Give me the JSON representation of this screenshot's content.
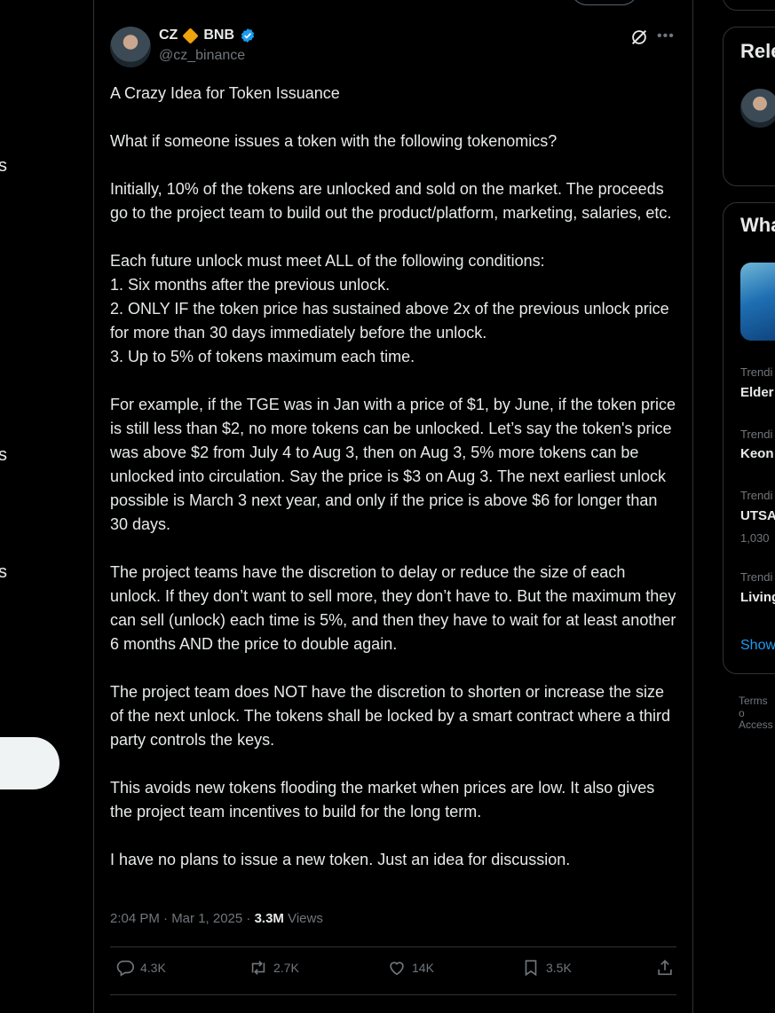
{
  "left_nav": {
    "frag_1": "s",
    "frag_2": "s",
    "frag_3": "s"
  },
  "tweet": {
    "author_name": "CZ",
    "author_brand": "BNB",
    "author_handle": "@cz_binance",
    "body": "A Crazy Idea for Token Issuance\n\nWhat if someone issues a token with the following tokenomics?\n\nInitially, 10% of the tokens are unlocked and sold on the market. The proceeds go to the project team to build out the product/platform, marketing, salaries, etc.\n\nEach future unlock must meet ALL of the following conditions:\n1. Six months after the previous unlock.\n2. ONLY IF the token price has sustained above 2x of the previous unlock price for more than 30 days immediately before the unlock.\n3. Up to 5% of tokens maximum each time.\n\nFor example, if the TGE was in Jan with a price of $1, by June, if the token price is still less than $2, no more tokens can be unlocked. Let’s say the token's price was above $2 from July 4 to Aug 3, then on Aug 3, 5% more tokens can be unlocked into circulation. Say the price is $3 on Aug 3. The next earliest unlock possible is March 3 next year, and only if the price is above $6 for longer than 30 days.\n\nThe project teams have the discretion to delay or reduce the size of each unlock. If they don’t want to sell more, they don’t have to. But the maximum they can sell (unlock) each time is 5%, and then they have to wait for at least another 6 months AND the price to double again.\n\nThe project team does NOT have the discretion to shorten or increase the size of the next unlock. The tokens shall be locked by a smart contract where a third party controls the keys.\n\nThis avoids new tokens flooding the market when prices are low. It also gives the project team incentives to build for the long term.\n\nI have no plans to issue a new token. Just an idea for discussion.",
    "timestamp": "2:04 PM · Mar 1, 2025 · ",
    "views_count": "3.3M",
    "views_label": " Views",
    "replies": "4.3K",
    "reposts": "2.7K",
    "likes": "14K",
    "bookmarks": "3.5K"
  },
  "right_sidebar": {
    "relevant_title": "Rele",
    "whats_title": "Wha",
    "trends": [
      {
        "label": "Trendi",
        "name": "Elder",
        "count": ""
      },
      {
        "label": "Trendi",
        "name": "Keon",
        "count": ""
      },
      {
        "label": "Trendi",
        "name": "UTSA",
        "count": "1,030"
      },
      {
        "label": "Trendi",
        "name": "Living",
        "count": ""
      }
    ],
    "show_more": "Show",
    "footer_1": "Terms o",
    "footer_2": "Access"
  },
  "colors": {
    "background": "#000000",
    "text": "#e7e9ea",
    "muted": "#71767b",
    "border": "#2f3336",
    "accent": "#1d9bf0",
    "bnb": "#f0a30a"
  }
}
